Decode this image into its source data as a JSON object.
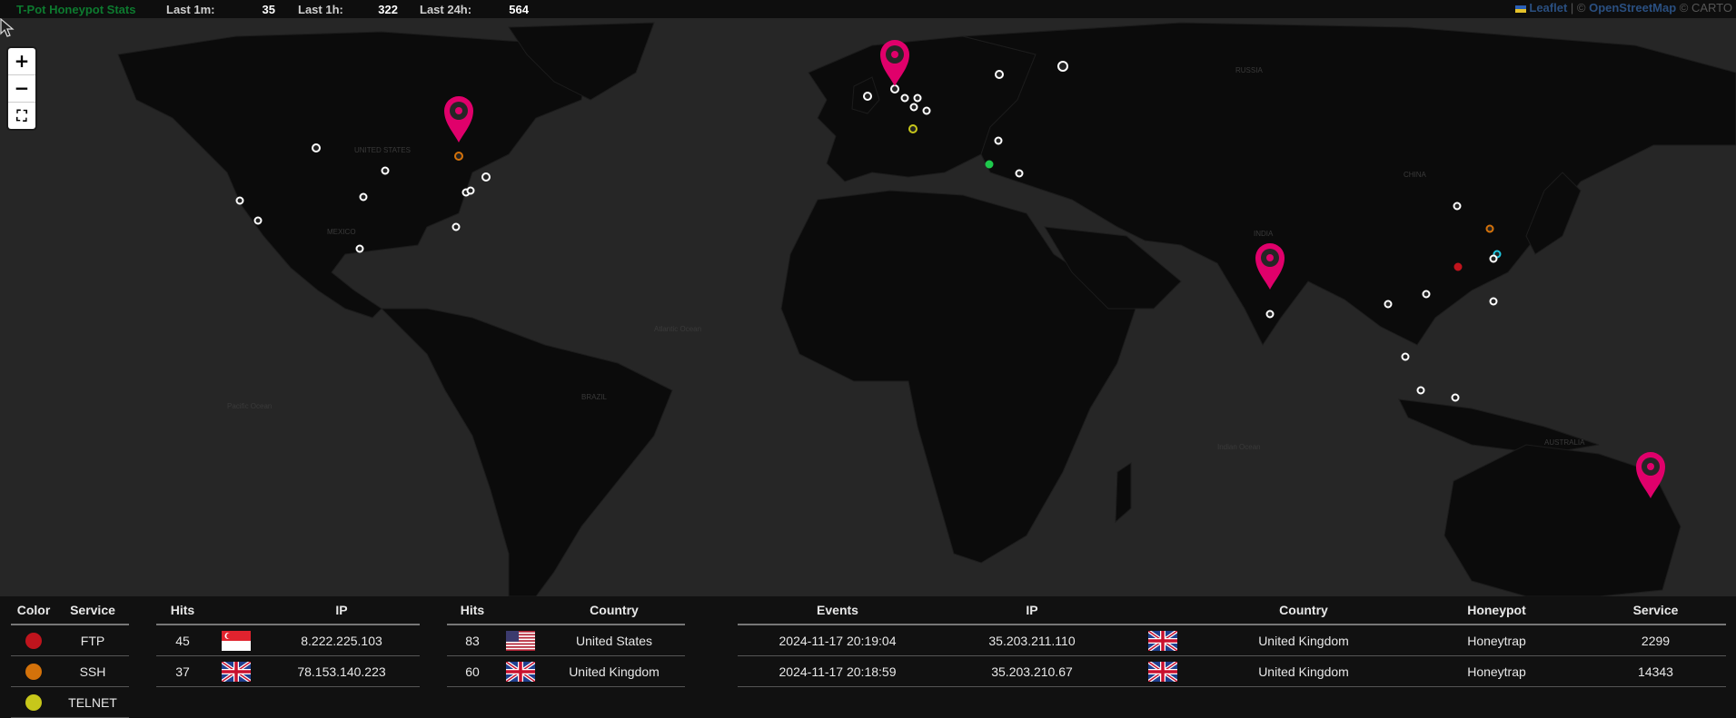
{
  "header": {
    "title": "T-Pot Honeypot Stats",
    "last_1m_label": "Last 1m:",
    "last_1m_value": "35",
    "last_1h_label": "Last 1h:",
    "last_1h_value": "322",
    "last_24h_label": "Last 24h:",
    "last_24h_value": "564"
  },
  "attribution": {
    "leaflet": "Leaflet",
    "separator": " | © ",
    "osm": "OpenStreetMap",
    "carto": " © CARTO"
  },
  "map_controls": {
    "zoom_in": "+",
    "zoom_out": "−",
    "fullscreen": "⛶"
  },
  "map_labels": {
    "atlantic": "Atlantic Ocean",
    "indian": "Indian Ocean",
    "pacific": "Pacific Ocean",
    "usa": "UNITED STATES",
    "mexico": "MEXICO",
    "brazil": "BRAZIL",
    "russia": "RUSSIA",
    "china": "CHINA",
    "india": "INDIA",
    "australia": "AUSTRALIA"
  },
  "colors": {
    "background": "#111111",
    "map_water": "#262626",
    "map_land": "#0b0b0b",
    "marker_pin": "#e0006b",
    "title_green": "#0d7a2f",
    "ftp": "#c0141d",
    "ssh": "#d4720a",
    "telnet": "#c7c71a"
  },
  "legend": {
    "headers": {
      "color": "Color",
      "service": "Service"
    },
    "rows": [
      {
        "color": "#c0141d",
        "service": "FTP"
      },
      {
        "color": "#d4720a",
        "service": "SSH"
      },
      {
        "color": "#c7c71a",
        "service": "TELNET"
      }
    ]
  },
  "ip_table": {
    "headers": {
      "hits": "Hits",
      "flag": "",
      "ip": "IP"
    },
    "rows": [
      {
        "hits": "45",
        "flag": "singapore-flag",
        "ip": "8.222.225.103"
      },
      {
        "hits": "37",
        "flag": "uk-flag",
        "ip": "78.153.140.223"
      }
    ]
  },
  "country_table": {
    "headers": {
      "hits": "Hits",
      "flag": "",
      "country": "Country"
    },
    "rows": [
      {
        "hits": "83",
        "flag": "us-flag",
        "country": "United States"
      },
      {
        "hits": "60",
        "flag": "uk-flag",
        "country": "United Kingdom"
      }
    ]
  },
  "events_table": {
    "headers": {
      "events": "Events",
      "ip": "IP",
      "flag": "",
      "country": "Country",
      "honeypot": "Honeypot",
      "service": "Service"
    },
    "rows": [
      {
        "events": "2024-11-17 20:19:04",
        "ip": "35.203.211.110",
        "flag": "uk-flag",
        "country": "United Kingdom",
        "honeypot": "Honeytrap",
        "service": "2299"
      },
      {
        "events": "2024-11-17 20:18:59",
        "ip": "35.203.210.67",
        "flag": "uk-flag",
        "country": "United Kingdom",
        "honeypot": "Honeytrap",
        "service": "14343"
      }
    ]
  }
}
